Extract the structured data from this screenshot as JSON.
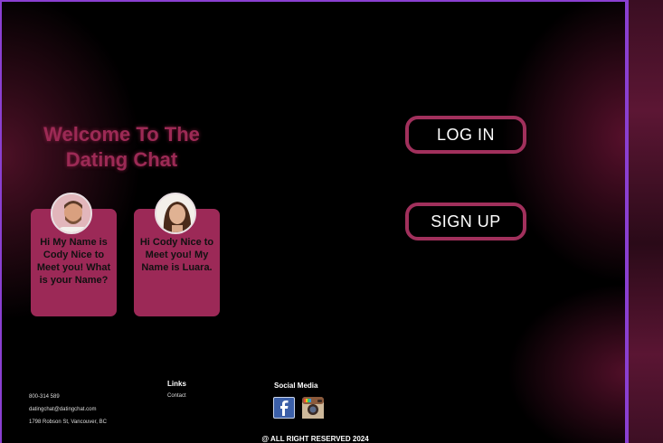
{
  "hero": {
    "title_line1": "Welcome To The",
    "title_line2": "Dating Chat"
  },
  "cards": [
    {
      "message": "Hi My Name is Cody Nice to Meet you! What is your Name?"
    },
    {
      "message": "Hi Cody Nice to Meet you! My Name is Luara."
    }
  ],
  "auth": {
    "login_label": "LOG IN",
    "signup_label": "SIGN UP"
  },
  "footer": {
    "phone": "800-314 589",
    "email": "datingchat@datingchat.com",
    "address": "1798 Robson St, Vancouver, BC",
    "links_heading": "Links",
    "contact_link": "Contact",
    "social_heading": "Social Media",
    "copyright": "@ ALL RIGHT RESERVED  2024"
  },
  "icons": {
    "facebook": "facebook-icon",
    "instagram": "instagram-icon"
  },
  "colors": {
    "accent": "#9c2957",
    "border": "#a1305c",
    "frame": "#8a3fd1"
  }
}
